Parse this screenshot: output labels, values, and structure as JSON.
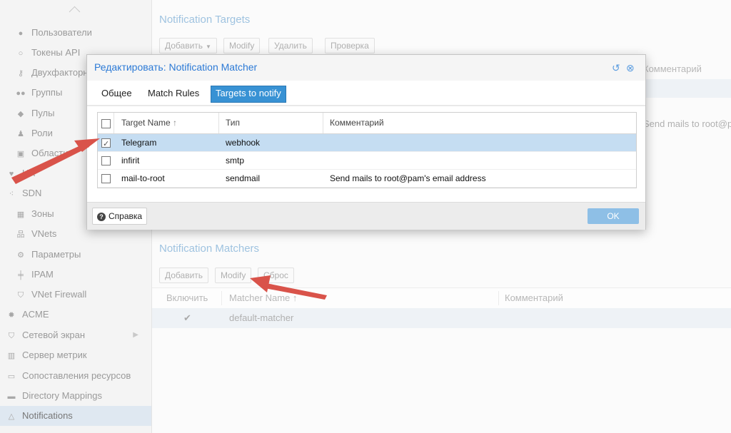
{
  "sidebar": {
    "items": [
      {
        "label": "Пользователи",
        "icon": "user-icon"
      },
      {
        "label": "Токены API",
        "icon": "user-outline-icon"
      },
      {
        "label": "Двухфакторная",
        "icon": "key-icon"
      },
      {
        "label": "Группы",
        "icon": "users-icon"
      },
      {
        "label": "Пулы",
        "icon": "tags-icon"
      },
      {
        "label": "Роли",
        "icon": "male-icon"
      },
      {
        "label": "Области",
        "icon": "address-book-icon"
      },
      {
        "label": "HA",
        "icon": "heartbeat-icon"
      },
      {
        "label": "SDN",
        "icon": "sdn-icon"
      },
      {
        "label": "Зоны",
        "icon": "grid-icon"
      },
      {
        "label": "VNets",
        "icon": "sitemap-icon"
      },
      {
        "label": "Параметры",
        "icon": "gear-icon"
      },
      {
        "label": "IPAM",
        "icon": "ipam-icon"
      },
      {
        "label": "VNet Firewall",
        "icon": "shield-icon"
      },
      {
        "label": "ACME",
        "icon": "certificate-icon"
      },
      {
        "label": "Сетевой экран",
        "icon": "shield-icon"
      },
      {
        "label": "Сервер метрик",
        "icon": "bar-chart-icon"
      },
      {
        "label": "Сопоставления ресурсов",
        "icon": "folder-outline-icon"
      },
      {
        "label": "Directory Mappings",
        "icon": "folder-icon"
      },
      {
        "label": "Notifications",
        "icon": "bell-icon"
      }
    ]
  },
  "main": {
    "targets": {
      "title": "Notification Targets",
      "toolbar": {
        "add": "Добавить",
        "modify": "Modify",
        "delete": "Удалить",
        "test": "Проверка"
      },
      "col_comment": "Комментарий",
      "row_comment": "Send mails to root@p"
    },
    "matchers": {
      "title": "Notification Matchers",
      "toolbar": {
        "add": "Добавить",
        "modify": "Modify",
        "reset": "Сброс"
      },
      "columns": {
        "enable": "Включить",
        "name": "Matcher Name ↑",
        "comment": "Комментарий"
      },
      "rows": [
        {
          "enabled": "✔",
          "name": "default-matcher",
          "comment": ""
        }
      ]
    }
  },
  "modal": {
    "title": "Редактировать: Notification Matcher",
    "tabs": [
      "Общее",
      "Match Rules",
      "Targets to notify"
    ],
    "active_tab": "Targets to notify",
    "table": {
      "columns": {
        "name": "Target Name",
        "sort": "↑",
        "type": "Тип",
        "comment": "Комментарий"
      },
      "rows": [
        {
          "name": "Telegram",
          "type": "webhook",
          "comment": "",
          "checked": true,
          "selected": true
        },
        {
          "name": "infirit",
          "type": "smtp",
          "comment": "",
          "checked": false,
          "selected": false
        },
        {
          "name": "mail-to-root",
          "type": "sendmail",
          "comment": "Send mails to root@pam's email address",
          "checked": false,
          "selected": false
        }
      ]
    },
    "footer": {
      "help": "Справка",
      "ok": "OK"
    }
  },
  "annotation_color": "#d9534a"
}
